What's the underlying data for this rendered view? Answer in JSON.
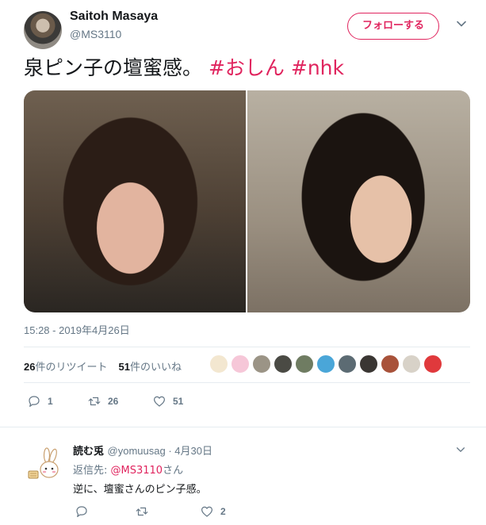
{
  "user": {
    "display_name": "Saitoh Masaya",
    "handle": "@MS3110",
    "follow_label": "フォローする"
  },
  "tweet": {
    "text": "泉ピン子の壇蜜感。",
    "hashtags": [
      "#おしん",
      "#nhk"
    ],
    "timestamp": "15:28 - 2019年4月26日",
    "retweets": "26",
    "retweets_label": "件のリツイート",
    "likes": "51",
    "likes_label": "件のいいね"
  },
  "actions": {
    "reply_count": "1",
    "retweet_count": "26",
    "like_count": "51"
  },
  "reply": {
    "display_name": "読む兎",
    "handle_date": "@yomuusag · 4月30日",
    "reply_to_prefix": "返信先: ",
    "reply_to_mention": "@MS3110",
    "reply_to_suffix": "さん",
    "text": "逆に、壇蜜さんのピン子感。",
    "like_count": "2"
  },
  "colors": {
    "accent": "#e0245e",
    "secondary_text": "#657786",
    "divider": "#e6ecf0"
  },
  "icons": [
    "chevron-down-icon",
    "reply-icon",
    "retweet-icon",
    "heart-icon",
    "rabbit-avatar-icon"
  ]
}
